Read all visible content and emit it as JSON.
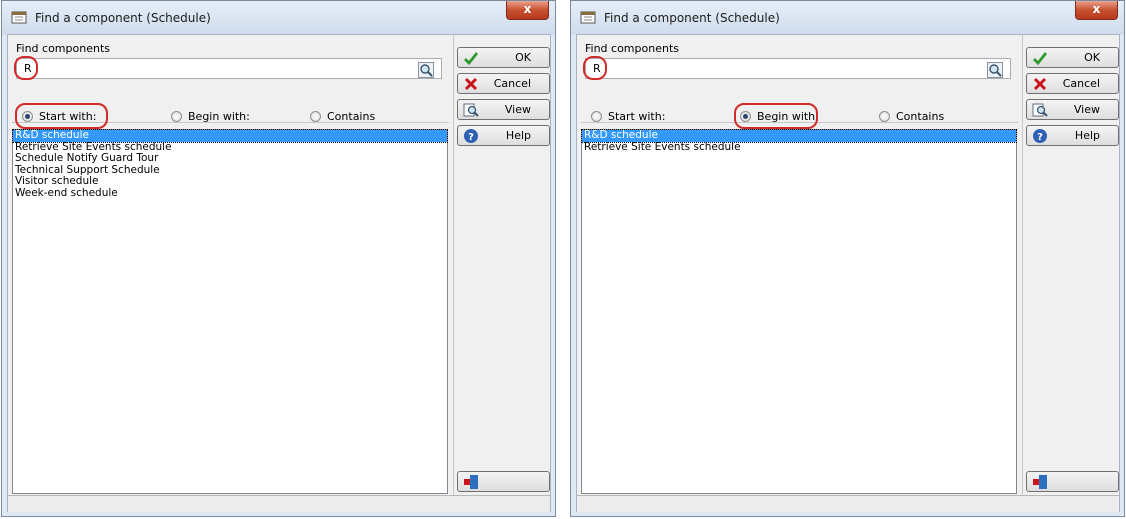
{
  "windows": [
    {
      "title": "Find a component (Schedule)",
      "close_label": "x",
      "group_label": "Find components",
      "search_value": "R",
      "radios": [
        {
          "label": "Start with:",
          "checked": true
        },
        {
          "label": "Begin with:",
          "checked": false
        },
        {
          "label": "Contains",
          "checked": false
        }
      ],
      "buttons": {
        "ok": "OK",
        "cancel": "Cancel",
        "view": "View",
        "help": "Help"
      },
      "items": [
        "R&D schedule",
        "Retrieve Site Events schedule",
        "Schedule Notify Guard Tour",
        "Technical Support Schedule",
        "Visitor schedule",
        "Week-end schedule"
      ]
    },
    {
      "title": "Find a component (Schedule)",
      "close_label": "x",
      "group_label": "Find components",
      "search_value": "R",
      "radios": [
        {
          "label": "Start with:",
          "checked": false
        },
        {
          "label": "Begin with:",
          "checked": true
        },
        {
          "label": "Contains",
          "checked": false
        }
      ],
      "buttons": {
        "ok": "OK",
        "cancel": "Cancel",
        "view": "View",
        "help": "Help"
      },
      "items": [
        "R&D schedule",
        "Retrieve Site Events schedule"
      ]
    }
  ],
  "colors": {
    "highlight": "#d12a2a",
    "selection": "#3399ff"
  }
}
